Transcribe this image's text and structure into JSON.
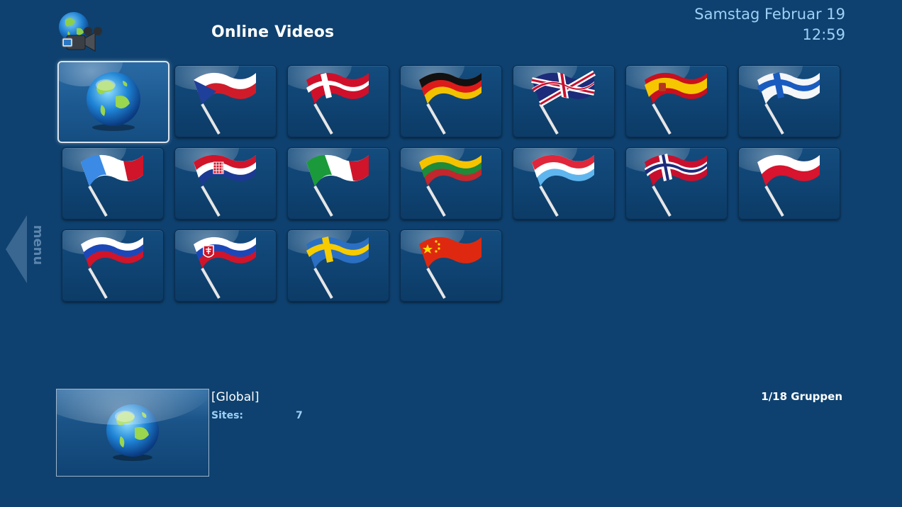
{
  "header": {
    "title": "Online Videos",
    "date": "Samstag Februar 19",
    "time": "12:59",
    "app_icon": "globe-camera-icon"
  },
  "side_menu": {
    "label": "menu"
  },
  "groups": [
    {
      "name": "Global",
      "icon": "globe-icon",
      "selected": true
    },
    {
      "name": "Czech Republic",
      "icon": "flag-czech-icon"
    },
    {
      "name": "Denmark",
      "icon": "flag-denmark-icon"
    },
    {
      "name": "Germany",
      "icon": "flag-germany-icon"
    },
    {
      "name": "United Kingdom",
      "icon": "flag-uk-icon"
    },
    {
      "name": "Spain",
      "icon": "flag-spain-icon"
    },
    {
      "name": "Finland",
      "icon": "flag-finland-icon"
    },
    {
      "name": "France",
      "icon": "flag-france-icon"
    },
    {
      "name": "Croatia",
      "icon": "flag-croatia-icon"
    },
    {
      "name": "Italy",
      "icon": "flag-italy-icon"
    },
    {
      "name": "Lithuania",
      "icon": "flag-lithuania-icon"
    },
    {
      "name": "Luxembourg",
      "icon": "flag-luxembourg-icon"
    },
    {
      "name": "Norway",
      "icon": "flag-norway-icon"
    },
    {
      "name": "Poland",
      "icon": "flag-poland-icon"
    },
    {
      "name": "Russia",
      "icon": "flag-russia-icon"
    },
    {
      "name": "Slovakia",
      "icon": "flag-slovakia-icon"
    },
    {
      "name": "Sweden",
      "icon": "flag-sweden-icon"
    },
    {
      "name": "China",
      "icon": "flag-china-icon"
    }
  ],
  "details": {
    "name": "[Global]",
    "sites_label": "Sites:",
    "sites_value": "7",
    "preview_icon": "globe-icon"
  },
  "status": {
    "group_count": "1/18 Gruppen"
  },
  "colors": {
    "background": "#0e416f",
    "accent_text": "#9fd0f6"
  }
}
